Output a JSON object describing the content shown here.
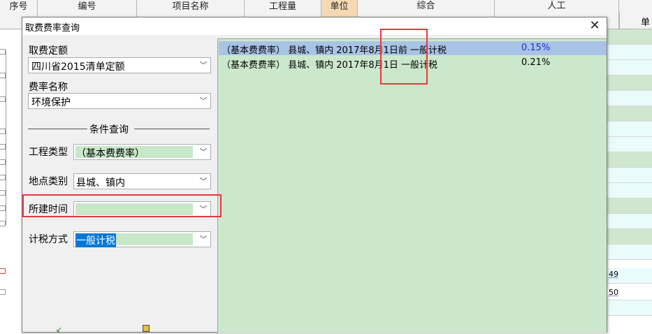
{
  "background": {
    "headers": [
      "序号",
      "编号",
      "项目名称",
      "工程量",
      "单位",
      "综合",
      "人工",
      "单"
    ],
    "right_values": [
      "49",
      "50"
    ]
  },
  "dialog": {
    "title": "取费费率查询",
    "close_icon": "close-icon",
    "fee_quota": {
      "label": "取费定额",
      "value": "四川省2015清单定额"
    },
    "rate_name": {
      "label": "费率名称",
      "value": "环境保护"
    },
    "conditions_title": "条件查询",
    "project_type": {
      "label": "工程类型",
      "value": "（基本费费率）"
    },
    "location_type": {
      "label": "地点类别",
      "value": "县城、镇内"
    },
    "build_time": {
      "label": "所建时间",
      "value": ""
    },
    "tax_method": {
      "label": "计税方式",
      "value": "一般计税"
    },
    "results": [
      {
        "desc": "（基本费费率） 县城、镇内 2017年8月1日前 一般计税",
        "rate": "0.15%"
      },
      {
        "desc": "（基本费费率） 县城、镇内 2017年8月1日 一般计税",
        "rate": "0.21%"
      }
    ]
  },
  "colors": {
    "results_bg": "#cce8cc",
    "selected_row": "#a9c3e6",
    "highlight_box": "#e8373a",
    "selection_blue": "#0078d7"
  }
}
